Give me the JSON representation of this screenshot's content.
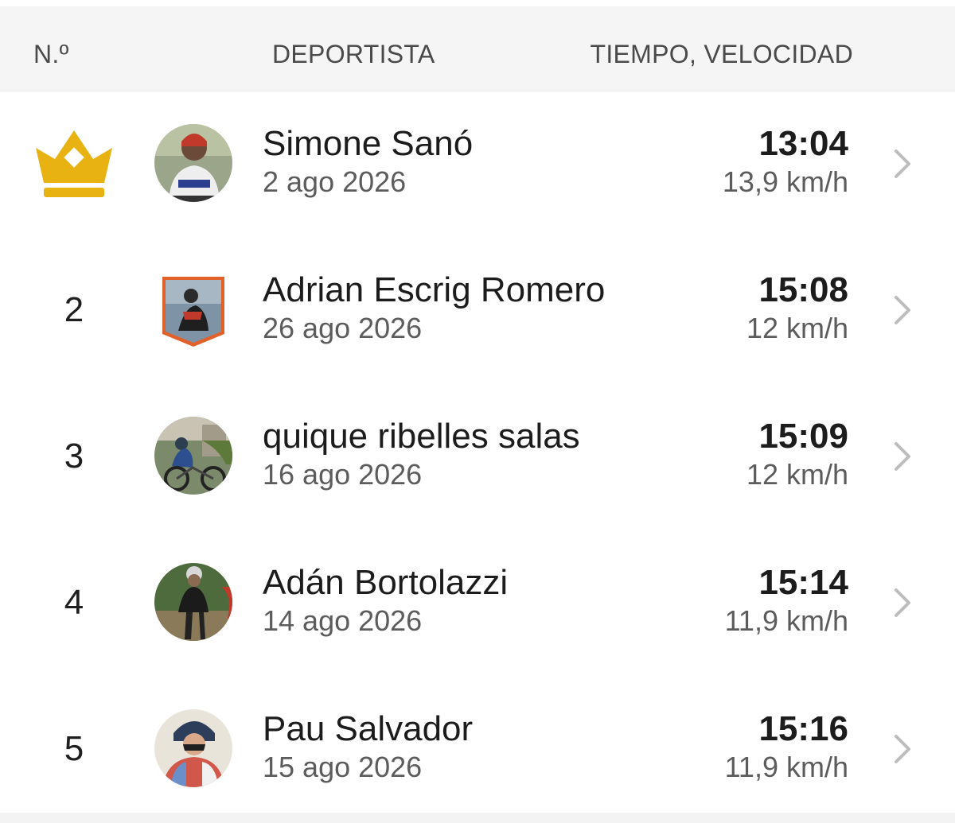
{
  "header": {
    "rank_label": "N.º",
    "athlete_label": "DEPORTISTA",
    "time_label": "TIEMPO, VELOCIDAD"
  },
  "colors": {
    "crown": "#E8B213",
    "header_bg": "#F5F5F5",
    "chevron": "#BDBDBD"
  },
  "rows": [
    {
      "rank": "",
      "rank_icon": "crown-icon",
      "name": "Simone Sanó",
      "date": "2 ago 2026",
      "time": "13:04",
      "speed": "13,9 km/h"
    },
    {
      "rank": "2",
      "name": "Adrian Escrig Romero",
      "date": "26 ago 2026",
      "time": "15:08",
      "speed": "12 km/h"
    },
    {
      "rank": "3",
      "name": "quique ribelles salas",
      "date": "16 ago 2026",
      "time": "15:09",
      "speed": "12 km/h"
    },
    {
      "rank": "4",
      "name": "Adán Bortolazzi",
      "date": "14 ago 2026",
      "time": "15:14",
      "speed": "11,9 km/h"
    },
    {
      "rank": "5",
      "name": "Pau Salvador",
      "date": "15 ago 2026",
      "time": "15:16",
      "speed": "11,9 km/h"
    }
  ]
}
